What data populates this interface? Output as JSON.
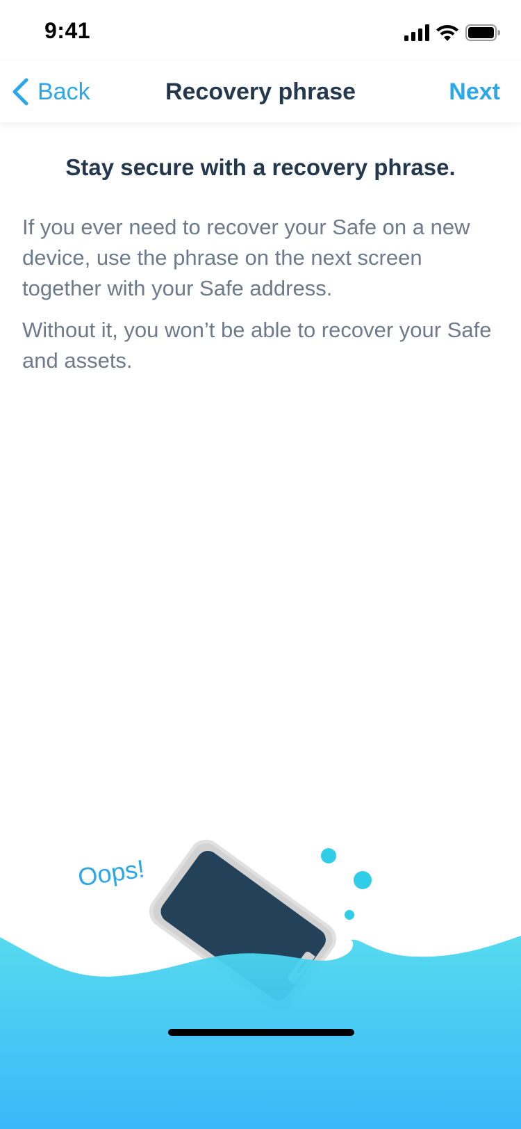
{
  "status_bar": {
    "time": "9:41"
  },
  "nav": {
    "back_label": "Back",
    "title": "Recovery phrase",
    "next_label": "Next"
  },
  "content": {
    "headline": "Stay secure with a recovery phrase.",
    "paragraph1": "If you ever need to recover your Safe on a new device, use the phrase on the next screen together with your Safe address.",
    "paragraph2": "Without it, you won’t be able to recover your Safe and assets."
  },
  "illustration": {
    "caption": "Oops!"
  },
  "colors": {
    "accent": "#2ba7e9",
    "title": "#24384d",
    "body": "#6c7a8b",
    "water_top": "#4dd8ee",
    "water_bottom": "#2fb4f8",
    "phone_screen": "#23425a"
  },
  "icons": [
    "signal-icon",
    "wifi-icon",
    "battery-icon",
    "chevron-left-icon"
  ]
}
